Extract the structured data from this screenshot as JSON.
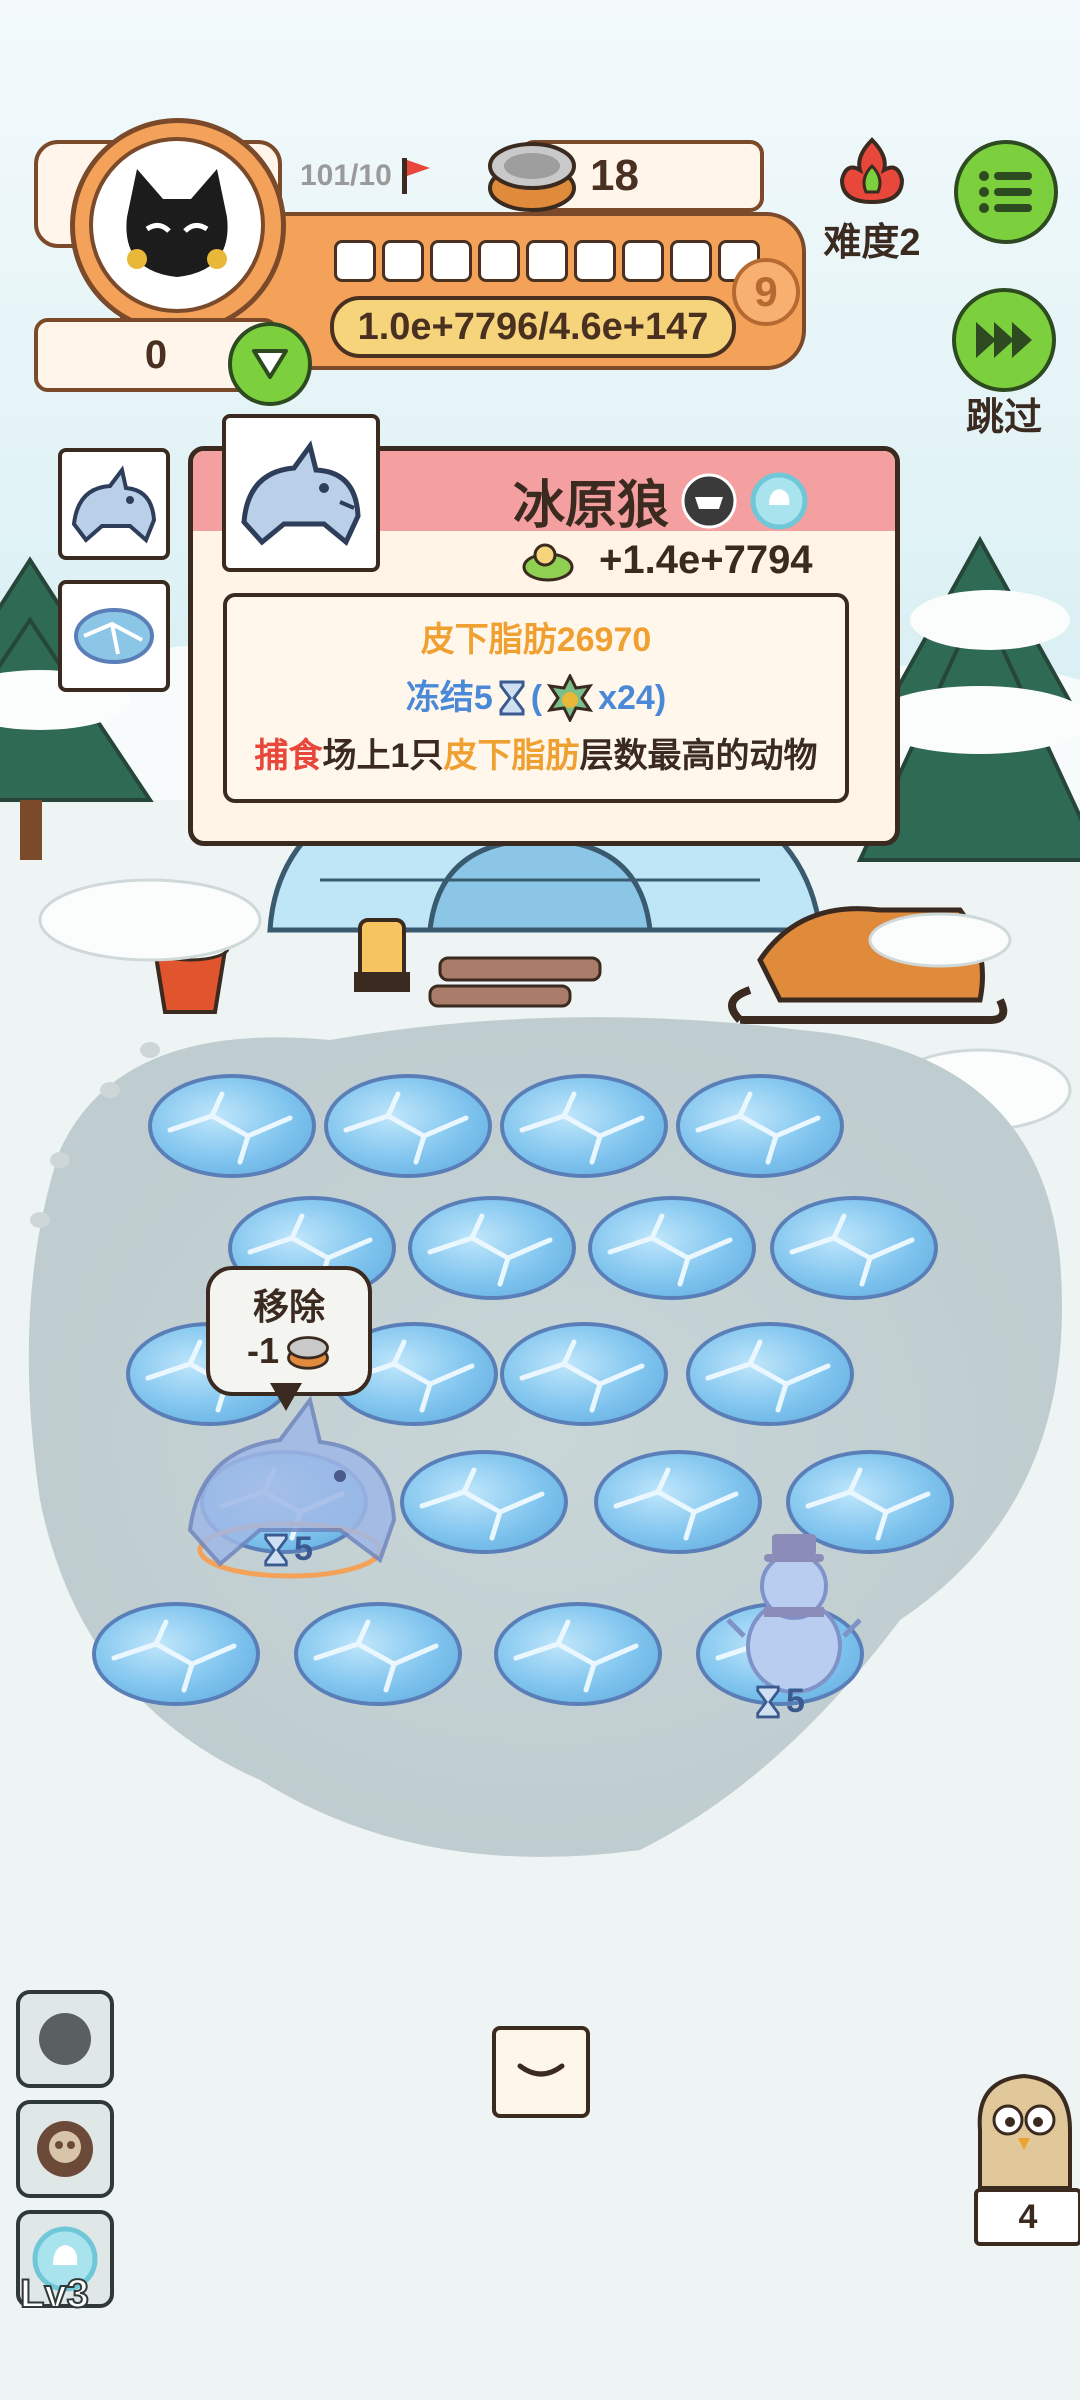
{
  "hud": {
    "avatar_counter": "0",
    "level_progress": "101/10",
    "cans": "18",
    "difficulty": "难度2",
    "big_number": "1.0e+7796/4.6e+147",
    "badge_number": "9",
    "skip_label": "跳过"
  },
  "card": {
    "title": "冰原狼",
    "reward": "+1.4e+7794",
    "stat_label": "皮下脂肪26970",
    "freeze_prefix": "冻结5",
    "freeze_suffix": "x24)",
    "freeze_open": "(",
    "desc_part1": "捕食",
    "desc_part2": "场上1只",
    "desc_part3": "皮下脂肪",
    "desc_part4": "层数最高的动物"
  },
  "board": {
    "remove_label": "移除",
    "remove_cost": "-1",
    "wolf_timer": "5",
    "snowman_timer": "5"
  },
  "bottom": {
    "level_label": "Lv3",
    "mascot_count": "4"
  },
  "colors": {
    "hud_orange": "#f4a25a",
    "menu_green": "#7ccf3d",
    "card_header_pink": "#f5a0a0",
    "stat_orange": "#f0a030",
    "freeze_blue": "#4a88d8",
    "prey_red": "#e8473c"
  }
}
